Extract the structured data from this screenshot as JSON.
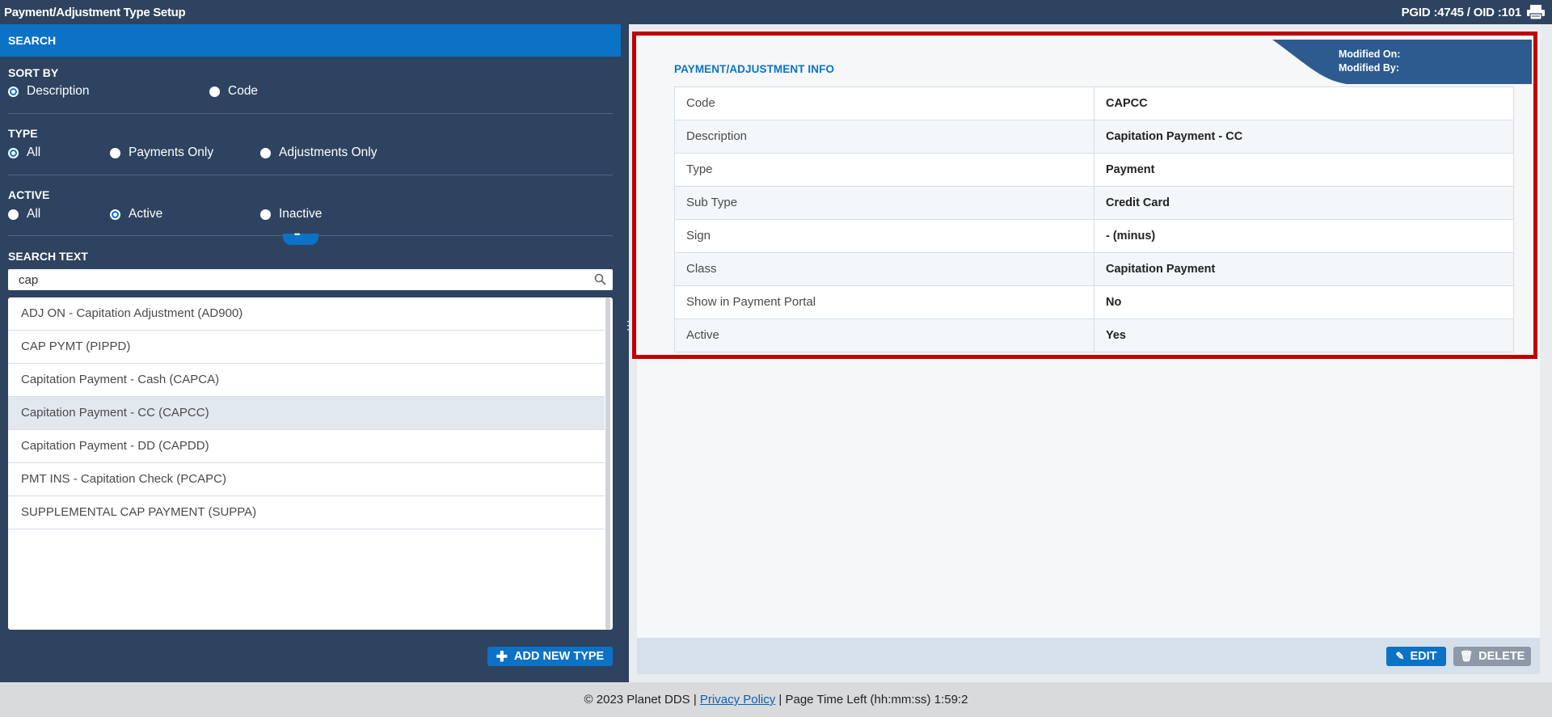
{
  "header": {
    "title": "Payment/Adjustment Type Setup",
    "ids": "PGID :4745  /  OID :101",
    "printer_icon": "printer-icon"
  },
  "search": {
    "header": "SEARCH",
    "sort_by": {
      "label": "SORT BY",
      "options": [
        "Description",
        "Code"
      ],
      "selected": "Description"
    },
    "type": {
      "label": "TYPE",
      "options": [
        "All",
        "Payments Only",
        "Adjustments Only"
      ],
      "selected": "All"
    },
    "active": {
      "label": "ACTIVE",
      "options": [
        "All",
        "Active",
        "Inactive"
      ],
      "selected": "Active"
    },
    "search_text": {
      "label": "SEARCH TEXT",
      "value": "cap"
    },
    "results": [
      "ADJ ON - Capitation Adjustment (AD900)",
      "CAP PYMT (PIPPD)",
      "Capitation Payment - Cash (CAPCA)",
      "Capitation Payment - CC (CAPCC)",
      "Capitation Payment - DD (CAPDD)",
      "PMT INS - Capitation Check (PCAPC)",
      "SUPPLEMENTAL CAP PAYMENT (SUPPA)"
    ],
    "selected_result": "Capitation Payment - CC (CAPCC)",
    "add_button": "ADD NEW TYPE"
  },
  "info": {
    "title": "PAYMENT/ADJUSTMENT INFO",
    "modified_on": "Modified On:",
    "modified_by": "Modified By:",
    "rows": [
      {
        "label": "Code",
        "value": "CAPCC"
      },
      {
        "label": "Description",
        "value": "Capitation Payment - CC"
      },
      {
        "label": "Type",
        "value": "Payment"
      },
      {
        "label": "Sub Type",
        "value": "Credit Card"
      },
      {
        "label": "Sign",
        "value": "- (minus)"
      },
      {
        "label": "Class",
        "value": "Capitation Payment"
      },
      {
        "label": "Show in Payment Portal",
        "value": "No"
      },
      {
        "label": "Active",
        "value": "Yes"
      }
    ],
    "edit_button": "EDIT",
    "delete_button": "DELETE"
  },
  "footer": {
    "copyright": "© 2023 Planet DDS | ",
    "privacy": "Privacy Policy",
    "time_left": " |  Page Time Left (hh:mm:ss) 1:59:2"
  },
  "colors": {
    "accent": "#0c72c6",
    "panel": "#2d4360",
    "highlight": "#c00000"
  }
}
